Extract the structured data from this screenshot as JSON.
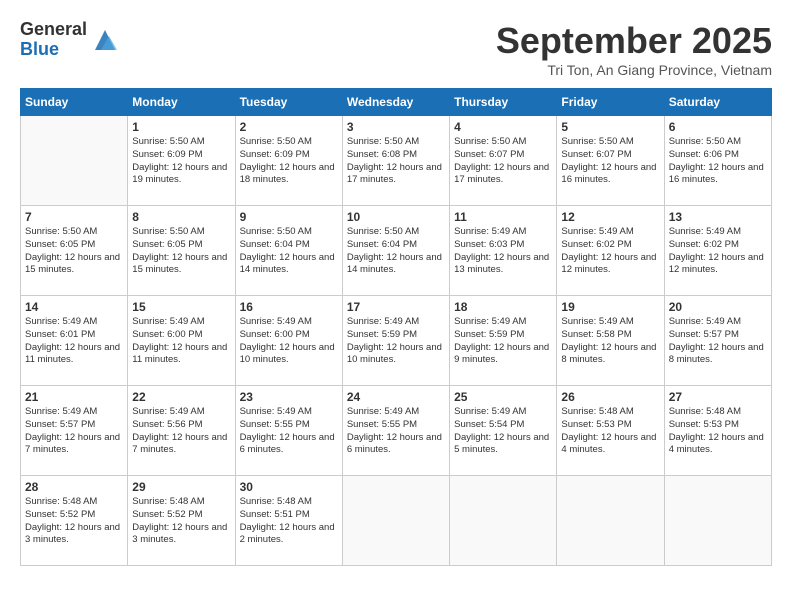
{
  "header": {
    "logo_line1": "General",
    "logo_line2": "Blue",
    "title": "September 2025",
    "subtitle": "Tri Ton, An Giang Province, Vietnam"
  },
  "weekdays": [
    "Sunday",
    "Monday",
    "Tuesday",
    "Wednesday",
    "Thursday",
    "Friday",
    "Saturday"
  ],
  "weeks": [
    [
      {
        "day": "",
        "info": ""
      },
      {
        "day": "1",
        "info": "Sunrise: 5:50 AM\nSunset: 6:09 PM\nDaylight: 12 hours\nand 19 minutes."
      },
      {
        "day": "2",
        "info": "Sunrise: 5:50 AM\nSunset: 6:09 PM\nDaylight: 12 hours\nand 18 minutes."
      },
      {
        "day": "3",
        "info": "Sunrise: 5:50 AM\nSunset: 6:08 PM\nDaylight: 12 hours\nand 17 minutes."
      },
      {
        "day": "4",
        "info": "Sunrise: 5:50 AM\nSunset: 6:07 PM\nDaylight: 12 hours\nand 17 minutes."
      },
      {
        "day": "5",
        "info": "Sunrise: 5:50 AM\nSunset: 6:07 PM\nDaylight: 12 hours\nand 16 minutes."
      },
      {
        "day": "6",
        "info": "Sunrise: 5:50 AM\nSunset: 6:06 PM\nDaylight: 12 hours\nand 16 minutes."
      }
    ],
    [
      {
        "day": "7",
        "info": "Sunrise: 5:50 AM\nSunset: 6:05 PM\nDaylight: 12 hours\nand 15 minutes."
      },
      {
        "day": "8",
        "info": "Sunrise: 5:50 AM\nSunset: 6:05 PM\nDaylight: 12 hours\nand 15 minutes."
      },
      {
        "day": "9",
        "info": "Sunrise: 5:50 AM\nSunset: 6:04 PM\nDaylight: 12 hours\nand 14 minutes."
      },
      {
        "day": "10",
        "info": "Sunrise: 5:50 AM\nSunset: 6:04 PM\nDaylight: 12 hours\nand 14 minutes."
      },
      {
        "day": "11",
        "info": "Sunrise: 5:49 AM\nSunset: 6:03 PM\nDaylight: 12 hours\nand 13 minutes."
      },
      {
        "day": "12",
        "info": "Sunrise: 5:49 AM\nSunset: 6:02 PM\nDaylight: 12 hours\nand 12 minutes."
      },
      {
        "day": "13",
        "info": "Sunrise: 5:49 AM\nSunset: 6:02 PM\nDaylight: 12 hours\nand 12 minutes."
      }
    ],
    [
      {
        "day": "14",
        "info": "Sunrise: 5:49 AM\nSunset: 6:01 PM\nDaylight: 12 hours\nand 11 minutes."
      },
      {
        "day": "15",
        "info": "Sunrise: 5:49 AM\nSunset: 6:00 PM\nDaylight: 12 hours\nand 11 minutes."
      },
      {
        "day": "16",
        "info": "Sunrise: 5:49 AM\nSunset: 6:00 PM\nDaylight: 12 hours\nand 10 minutes."
      },
      {
        "day": "17",
        "info": "Sunrise: 5:49 AM\nSunset: 5:59 PM\nDaylight: 12 hours\nand 10 minutes."
      },
      {
        "day": "18",
        "info": "Sunrise: 5:49 AM\nSunset: 5:59 PM\nDaylight: 12 hours\nand 9 minutes."
      },
      {
        "day": "19",
        "info": "Sunrise: 5:49 AM\nSunset: 5:58 PM\nDaylight: 12 hours\nand 8 minutes."
      },
      {
        "day": "20",
        "info": "Sunrise: 5:49 AM\nSunset: 5:57 PM\nDaylight: 12 hours\nand 8 minutes."
      }
    ],
    [
      {
        "day": "21",
        "info": "Sunrise: 5:49 AM\nSunset: 5:57 PM\nDaylight: 12 hours\nand 7 minutes."
      },
      {
        "day": "22",
        "info": "Sunrise: 5:49 AM\nSunset: 5:56 PM\nDaylight: 12 hours\nand 7 minutes."
      },
      {
        "day": "23",
        "info": "Sunrise: 5:49 AM\nSunset: 5:55 PM\nDaylight: 12 hours\nand 6 minutes."
      },
      {
        "day": "24",
        "info": "Sunrise: 5:49 AM\nSunset: 5:55 PM\nDaylight: 12 hours\nand 6 minutes."
      },
      {
        "day": "25",
        "info": "Sunrise: 5:49 AM\nSunset: 5:54 PM\nDaylight: 12 hours\nand 5 minutes."
      },
      {
        "day": "26",
        "info": "Sunrise: 5:48 AM\nSunset: 5:53 PM\nDaylight: 12 hours\nand 4 minutes."
      },
      {
        "day": "27",
        "info": "Sunrise: 5:48 AM\nSunset: 5:53 PM\nDaylight: 12 hours\nand 4 minutes."
      }
    ],
    [
      {
        "day": "28",
        "info": "Sunrise: 5:48 AM\nSunset: 5:52 PM\nDaylight: 12 hours\nand 3 minutes."
      },
      {
        "day": "29",
        "info": "Sunrise: 5:48 AM\nSunset: 5:52 PM\nDaylight: 12 hours\nand 3 minutes."
      },
      {
        "day": "30",
        "info": "Sunrise: 5:48 AM\nSunset: 5:51 PM\nDaylight: 12 hours\nand 2 minutes."
      },
      {
        "day": "",
        "info": ""
      },
      {
        "day": "",
        "info": ""
      },
      {
        "day": "",
        "info": ""
      },
      {
        "day": "",
        "info": ""
      }
    ]
  ]
}
